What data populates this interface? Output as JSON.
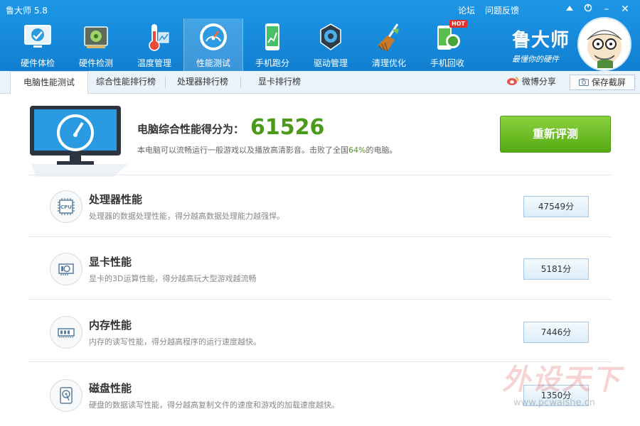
{
  "window": {
    "title": "鲁大师 5.8",
    "links": [
      "论坛",
      "问题反馈"
    ],
    "controls": [
      "skin-icon",
      "minimize-icon",
      "close-icon"
    ]
  },
  "toolbar": {
    "items": [
      {
        "label": "硬件体检",
        "icon": "health-check-icon"
      },
      {
        "label": "硬件检测",
        "icon": "hardware-board-icon"
      },
      {
        "label": "温度管理",
        "icon": "thermometer-icon"
      },
      {
        "label": "性能测试",
        "icon": "speedometer-icon",
        "active": true
      },
      {
        "label": "手机跑分",
        "icon": "phone-benchmark-icon"
      },
      {
        "label": "驱动管理",
        "icon": "gear-icon"
      },
      {
        "label": "清理优化",
        "icon": "broom-icon"
      },
      {
        "label": "手机回收",
        "icon": "phone-recycle-icon",
        "badge": "HOT"
      }
    ]
  },
  "brand": {
    "name": "鲁大师",
    "slogan": "最懂你的硬件"
  },
  "tabs": {
    "items": [
      "电脑性能测试",
      "综合性能排行榜",
      "处理器排行榜",
      "显卡排行榜"
    ],
    "share": "微博分享",
    "save": "保存截屏"
  },
  "score": {
    "label": "电脑综合性能得分为：",
    "value": "61526",
    "desc_prefix": "本电脑可以流畅运行一般游戏以及播放高清影音。击败了全国",
    "percent": "64%",
    "desc_suffix": "的电脑。",
    "retest": "重新评测"
  },
  "rows": [
    {
      "title": "处理器性能",
      "desc": "处理器的数据处理性能，得分越高数据处理能力越强悍。",
      "score": "47549分",
      "icon": "cpu-icon"
    },
    {
      "title": "显卡性能",
      "desc": "显卡的3D运算性能，得分越高玩大型游戏越流畅",
      "score": "5181分",
      "icon": "graphics-card-icon"
    },
    {
      "title": "内存性能",
      "desc": "内存的读写性能，得分越高程序的运行速度越快。",
      "score": "7446分",
      "icon": "memory-icon"
    },
    {
      "title": "磁盘性能",
      "desc": "硬盘的数据读写性能，得分越高复制文件的速度和游戏的加载速度越快。",
      "score": "1350分",
      "icon": "disk-icon"
    }
  ],
  "watermark": {
    "text": "外设天下",
    "url": "www.pcwaishe.cn"
  }
}
